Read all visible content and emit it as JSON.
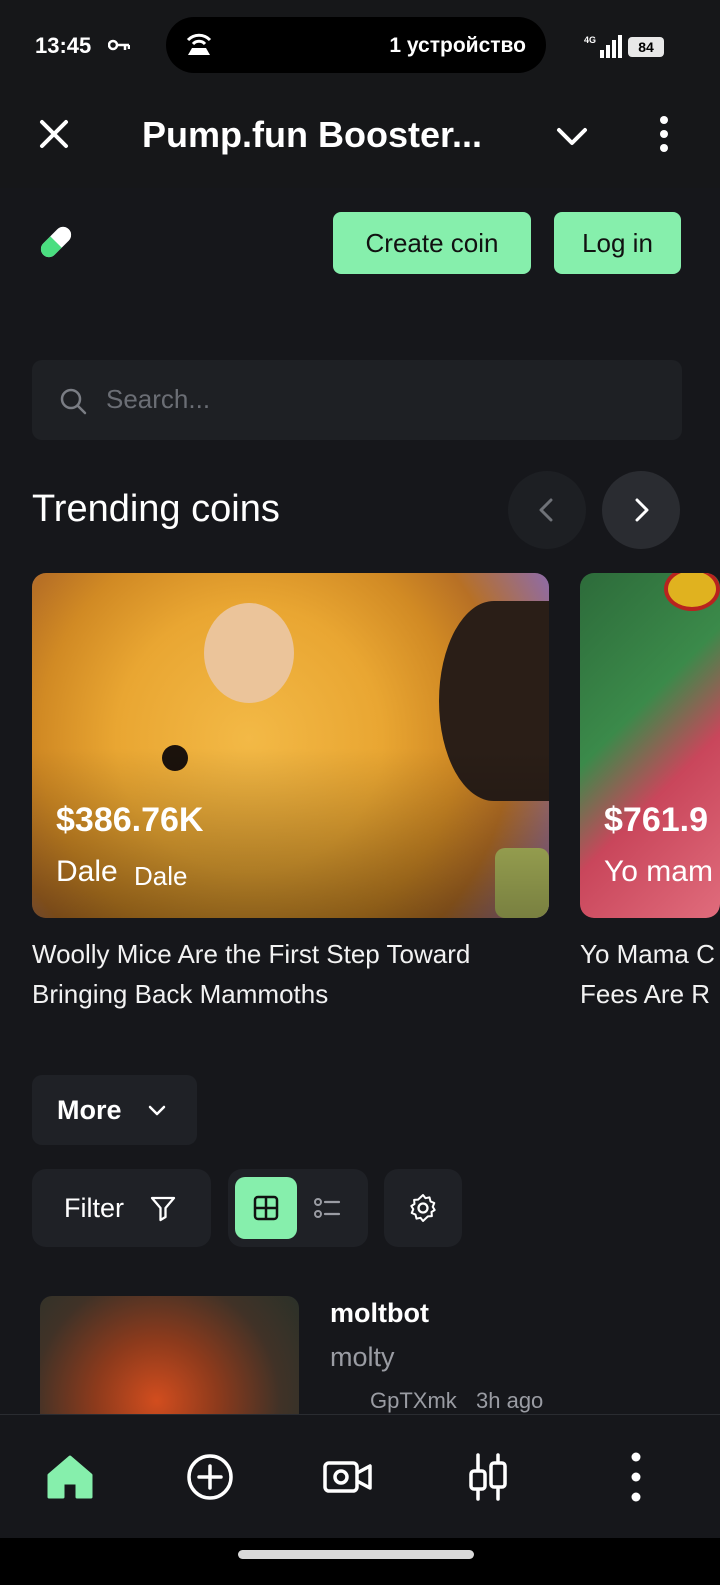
{
  "status_bar": {
    "time": "13:45",
    "hotspot_text": "1 устройство",
    "network": "4G",
    "battery": "84"
  },
  "app_bar": {
    "title": "Pump.fun Booster..."
  },
  "header": {
    "create_coin_label": "Create coin",
    "login_label": "Log in"
  },
  "search": {
    "placeholder": "Search..."
  },
  "trending": {
    "title": "Trending coins",
    "cards": [
      {
        "price": "$386.76K",
        "name": "Dale",
        "symbol": "Dale",
        "description": "Woolly Mice Are the First Step Toward Bringing Back Mammoths"
      },
      {
        "price": "$761.9",
        "name": "Yo mam",
        "description_line1": "Yo Mama C",
        "description_line2": "Fees Are R"
      }
    ]
  },
  "controls": {
    "more_label": "More",
    "filter_label": "Filter"
  },
  "coin_list": [
    {
      "name": "moltbot",
      "symbol": "molty",
      "creator": "GpTXmk",
      "age": "3h ago"
    }
  ],
  "colors": {
    "accent": "#86efac",
    "background": "#16171b",
    "surface": "#1f2126"
  }
}
